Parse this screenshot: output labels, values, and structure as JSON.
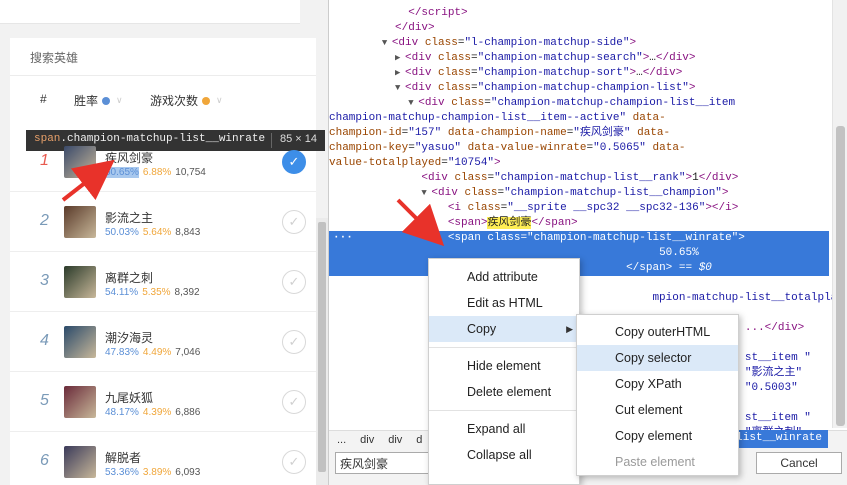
{
  "left_panel": {
    "search_label": "搜索英雄",
    "columns": {
      "rank": "#",
      "winrate": "胜率",
      "played": "游戏次数"
    },
    "colors": {
      "winrate_dot": "#5b8fd6",
      "played_dot": "#f0a63a"
    },
    "champions": [
      {
        "rank": "1",
        "name": "疾风剑豪",
        "winrate": "50.65%",
        "pickrate": "6.88%",
        "played": "10,754",
        "selected": true
      },
      {
        "rank": "2",
        "name": "影流之主",
        "winrate": "50.03%",
        "pickrate": "5.64%",
        "played": "8,843",
        "selected": false
      },
      {
        "rank": "3",
        "name": "离群之刺",
        "winrate": "54.11%",
        "pickrate": "5.35%",
        "played": "8,392",
        "selected": false
      },
      {
        "rank": "4",
        "name": "潮汐海灵",
        "winrate": "47.83%",
        "pickrate": "4.49%",
        "played": "7,046",
        "selected": false
      },
      {
        "rank": "5",
        "name": "九尾妖狐",
        "winrate": "48.17%",
        "pickrate": "4.39%",
        "played": "6,886",
        "selected": false
      },
      {
        "rank": "6",
        "name": "解脱者",
        "winrate": "53.36%",
        "pickrate": "3.89%",
        "played": "6,093",
        "selected": false
      }
    ]
  },
  "inspect_tooltip": {
    "tag": "span",
    "class_name": ".champion-matchup-list__winrate",
    "size": "85 × 14"
  },
  "devtools": {
    "breadcrumbs": [
      "...",
      "div",
      "div",
      "d"
    ],
    "breadcrumb_active": "hup-list__winrate",
    "find_value": "疾风剑豪",
    "cancel_label": "Cancel",
    "selected_text": "50.65%",
    "selected_suffix": "== $0",
    "partial_lines": {
      "l1": "mpion-matchup-list__totalplayed\">",
      "l2": "...</div>",
      "l3": "st__item \"",
      "l4": "\"影流之主\"",
      "l5": "\"0.5003\"",
      "l6": "st__item \"",
      "l7": "\"离群之刺\""
    }
  },
  "context_menu": {
    "items": [
      "Add attribute",
      "Edit as HTML",
      "Copy",
      "Hide element",
      "Delete element",
      "Expand all",
      "Collapse all"
    ],
    "copy_submenu": [
      "Copy outerHTML",
      "Copy selector",
      "Copy XPath",
      "Cut element",
      "Copy element",
      "Paste element"
    ]
  }
}
